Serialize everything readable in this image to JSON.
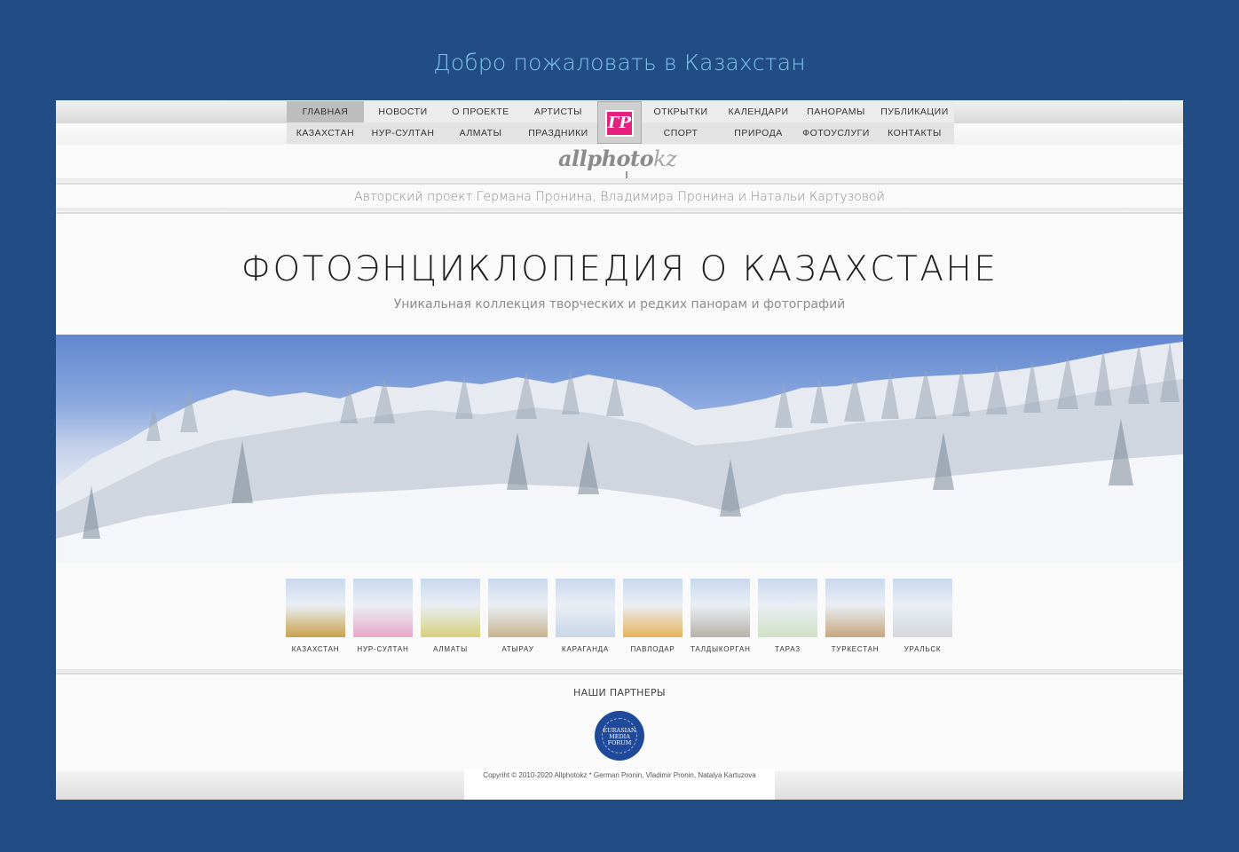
{
  "welcome": "Добро пожаловать в Казахстан",
  "nav": {
    "row1": [
      "ГЛАВНАЯ",
      "НОВОСТИ",
      "О ПРОЕКТЕ",
      "АРТИСТЫ",
      "ОТКРЫТКИ",
      "КАЛЕНДАРИ",
      "ПАНОРАМЫ",
      "ПУБЛИКАЦИИ"
    ],
    "row2": [
      "КАЗАХСТАН",
      "НУР-СУЛТАН",
      "АЛМАТЫ",
      "ПРАЗДНИКИ",
      "СПОРТ",
      "ПРИРОДА",
      "ФОТОУСЛУГИ",
      "КОНТАКТЫ"
    ],
    "logo_mark": "ГР"
  },
  "brand": {
    "main": "allphoto",
    "suffix": "kz"
  },
  "authors": "Авторский проект Германа Пронина, Владимира Пронина и Натальи Картузовой",
  "hero": {
    "title": "ФОТОЭНЦИКЛОПЕДИЯ О КАЗАХСТАНЕ",
    "subtitle": "Уникальная коллекция творческих и редких панорам и фотографий"
  },
  "cities": [
    {
      "label": "КАЗАХСТАН",
      "color": "#c9a24a"
    },
    {
      "label": "НУР-СУЛТАН",
      "color": "#e9a8c8"
    },
    {
      "label": "АЛМАТЫ",
      "color": "#d8d07a"
    },
    {
      "label": "АТЫРАУ",
      "color": "#c9b48e"
    },
    {
      "label": "КАРАГАНДА",
      "color": "#c8d6e6"
    },
    {
      "label": "ПАВЛОДАР",
      "color": "#e8b25a"
    },
    {
      "label": "ТАЛДЫКОРГАН",
      "color": "#b8b2a8"
    },
    {
      "label": "ТАРАЗ",
      "color": "#cfe2c4"
    },
    {
      "label": "ТУРКЕСТАН",
      "color": "#c7a67c"
    },
    {
      "label": "УРАЛЬСК",
      "color": "#d4d8dc"
    }
  ],
  "partners": {
    "title": "НАШИ ПАРТНЕРЫ",
    "logo": {
      "line1": "EURASIAN",
      "line2": "MEDIA",
      "line3": "FORUM"
    }
  },
  "footer": {
    "copyright": "Copyriht © 2010-2020 Allphotokz * German Pronin, Vladimir Pronin, Natalya Kartuzova"
  }
}
